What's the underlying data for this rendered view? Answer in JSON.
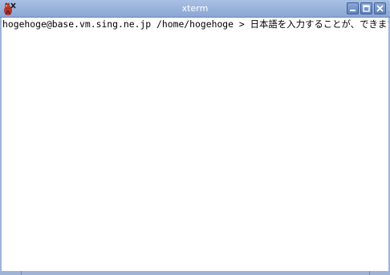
{
  "window": {
    "title": "xterm"
  },
  "terminal": {
    "prompt": "hogehoge@base.vm.sing.ne.jp /home/hogehoge > ",
    "input": "日本語を入力することが、できます。"
  },
  "icons": {
    "app": "xterm-icon",
    "minimize": "minimize-icon",
    "maximize": "maximize-icon",
    "close": "close-icon"
  },
  "colors": {
    "titlebar": "#8aa6d2",
    "frame": "#9db4d8",
    "terminal_bg": "#ffffff",
    "terminal_fg": "#000000"
  }
}
